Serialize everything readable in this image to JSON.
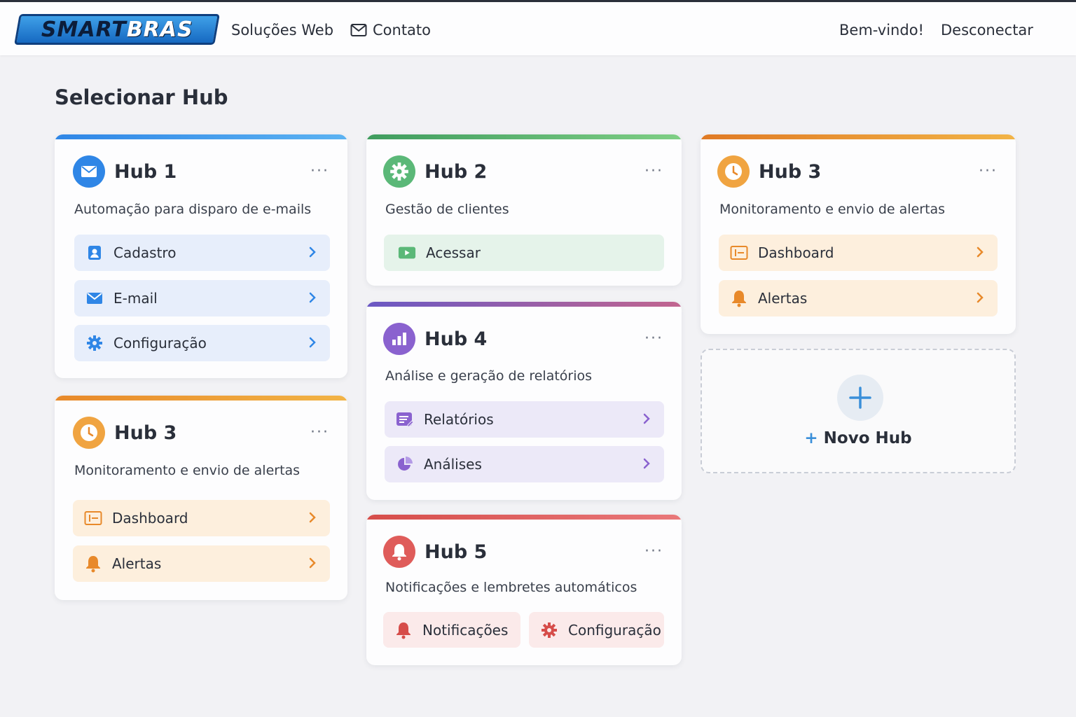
{
  "header": {
    "logo_text_dark": "SMART",
    "logo_text_light": "BRAS",
    "nav_solucoes": "Soluções Web",
    "nav_contato": "Contato",
    "welcome": "Bem-vindo!",
    "logout": "Desconectar"
  },
  "page": {
    "title": "Selecionar Hub"
  },
  "hubs": {
    "hub1": {
      "title": "Hub 1",
      "description": "Automação para disparo de e-mails",
      "buttons": [
        "Cadastro",
        "E-mail",
        "Configuração"
      ],
      "accent": "#2f86e6"
    },
    "hub2": {
      "title": "Hub 2",
      "description": "Gestão de clientes",
      "buttons": [
        "Acessar"
      ],
      "accent": "#4caf6e"
    },
    "hub3_top": {
      "title": "Hub 3",
      "description": "Monitoramento e envio de alertas",
      "buttons": [
        "Dashboard",
        "Alertas"
      ],
      "accent": "#e8892a"
    },
    "hub3_bottom": {
      "title": "Hub 3",
      "description": "Monitoramento e envio de alertas",
      "buttons": [
        "Dashboard",
        "Alertas"
      ],
      "accent": "#e8892a"
    },
    "hub4": {
      "title": "Hub 4",
      "description": "Análise e geração de relatórios",
      "buttons": [
        "Relatórios",
        "Análises"
      ],
      "accent": "#7a5cc8"
    },
    "hub5": {
      "title": "Hub 5",
      "description": "Notificações e lembretes automáticos",
      "buttons": [
        "Notificações",
        "Configuração"
      ],
      "accent": "#d9534f"
    }
  },
  "new_hub": {
    "plus": "+",
    "label": "Novo Hub"
  },
  "menu_dots": "···"
}
